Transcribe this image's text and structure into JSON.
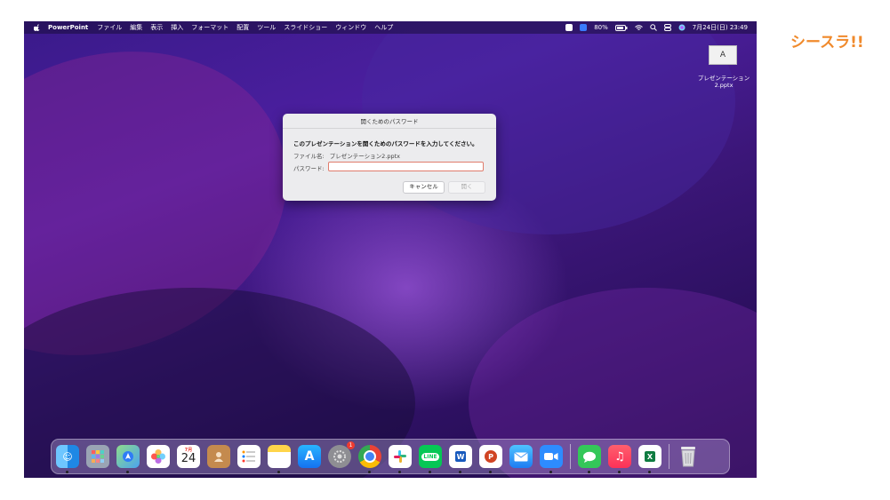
{
  "menubar": {
    "app_name": "PowerPoint",
    "menus": [
      "ファイル",
      "編集",
      "表示",
      "挿入",
      "フォーマット",
      "配置",
      "ツール",
      "スライドショー",
      "ウィンドウ",
      "ヘルプ"
    ],
    "battery": "80%",
    "datetime": "7月24日(日) 23:49"
  },
  "desktop": {
    "file_icon_text": "A",
    "file_name_line1": "プレゼンテーション",
    "file_name_line2": "2.pptx"
  },
  "dialog": {
    "title": "開くためのパスワード",
    "message": "このプレゼンテーションを開くためのパスワードを入力してください。",
    "file_label": "ファイル名:",
    "file_name": "プレゼンテーション2.pptx",
    "password_label": "パスワード:",
    "password_value": "",
    "cancel_label": "キャンセル",
    "open_label": "開く"
  },
  "dock": {
    "calendar_month": "7月",
    "calendar_day": "24",
    "settings_badge": "1",
    "apps": [
      "Finder",
      "Launchpad",
      "Maps",
      "Photos",
      "Calendar",
      "Contacts",
      "Reminders",
      "Notes",
      "App Store",
      "System Preferences",
      "Chrome",
      "Slack",
      "LINE",
      "Word",
      "PowerPoint",
      "Mail",
      "Zoom",
      "Messages",
      "Music",
      "Excel",
      "Trash"
    ]
  },
  "brand": {
    "logo_text": "シースラ!!"
  },
  "colors": {
    "brand": "#f08a2c",
    "dialog_focus": "#e07c6c",
    "wallpaper": "#3a1a8a"
  }
}
